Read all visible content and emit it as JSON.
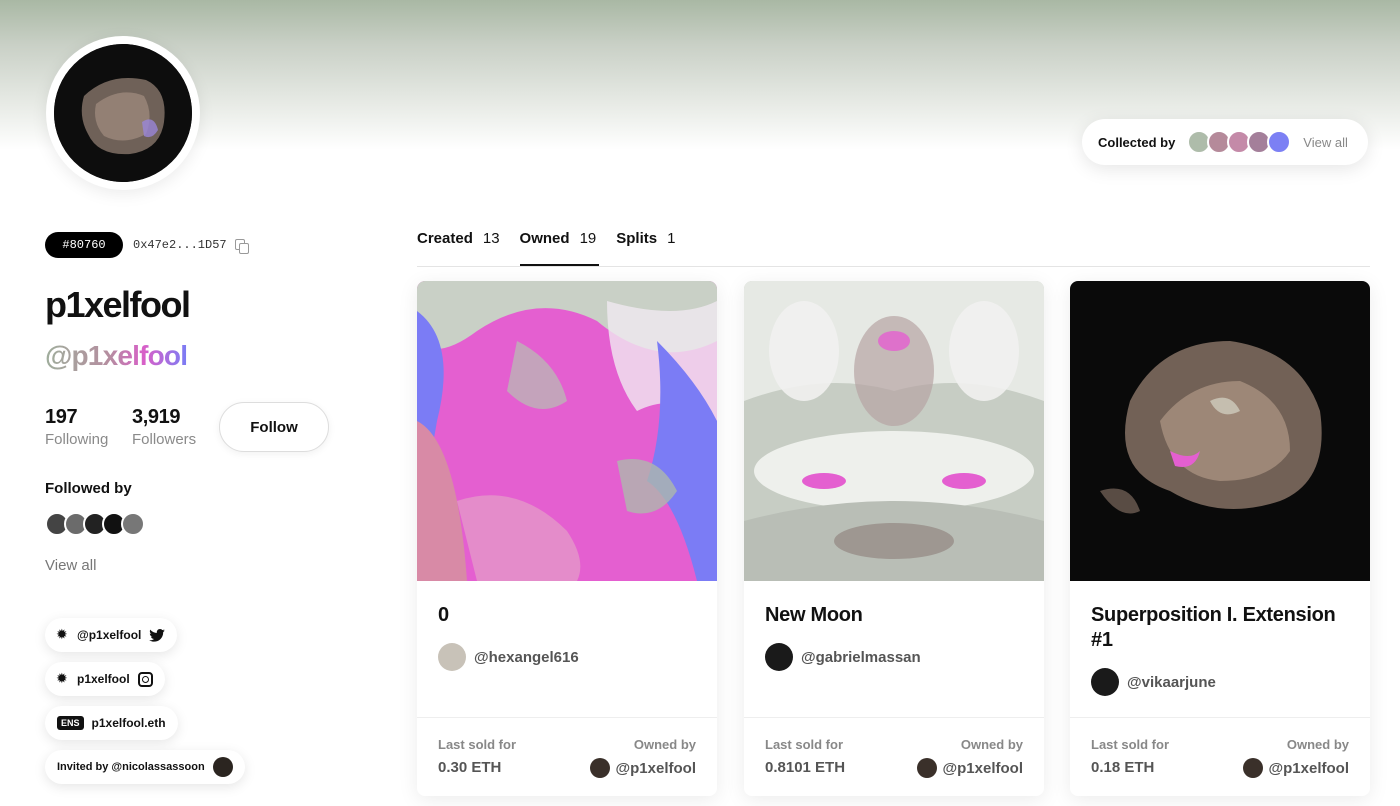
{
  "profile": {
    "id_badge": "#80760",
    "address": "0x47e2...1D57",
    "display_name": "p1xelfool",
    "handle": "@p1xelfool",
    "following_count": "197",
    "following_label": "Following",
    "followers_count": "3,919",
    "followers_label": "Followers",
    "follow_label": "Follow",
    "followed_by_title": "Followed by",
    "view_all_label": "View all",
    "twitter": "@p1xelfool",
    "instagram": "p1xelfool",
    "ens_badge": "ENS",
    "ens": "p1xelfool.eth",
    "invited_by": "Invited by @nicolassassoon"
  },
  "collected_by": {
    "label": "Collected by",
    "view_all": "View all",
    "avatar_colors": [
      "#aebcaa",
      "#b58a9a",
      "#c48aa8",
      "#a47f9a",
      "#7c80f4"
    ]
  },
  "followed_by_avatar_colors": [
    "#444",
    "#6b6b6b",
    "#222",
    "#111",
    "#777"
  ],
  "tabs": [
    {
      "label": "Created",
      "count": "13"
    },
    {
      "label": "Owned",
      "count": "19"
    },
    {
      "label": "Splits",
      "count": "1"
    }
  ],
  "active_tab": "Owned",
  "cards": [
    {
      "title": "0",
      "creator": "@hexangel616",
      "last_sold_label": "Last sold for",
      "price": "0.30 ETH",
      "owned_by_label": "Owned by",
      "owner": "@p1xelfool"
    },
    {
      "title": "New Moon",
      "creator": "@gabrielmassan",
      "last_sold_label": "Last sold for",
      "price": "0.8101 ETH",
      "owned_by_label": "Owned by",
      "owner": "@p1xelfool"
    },
    {
      "title": "Superposition I. Extension #1",
      "creator": "@vikaarjune",
      "last_sold_label": "Last sold for",
      "price": "0.18 ETH",
      "owned_by_label": "Owned by",
      "owner": "@p1xelfool"
    }
  ]
}
